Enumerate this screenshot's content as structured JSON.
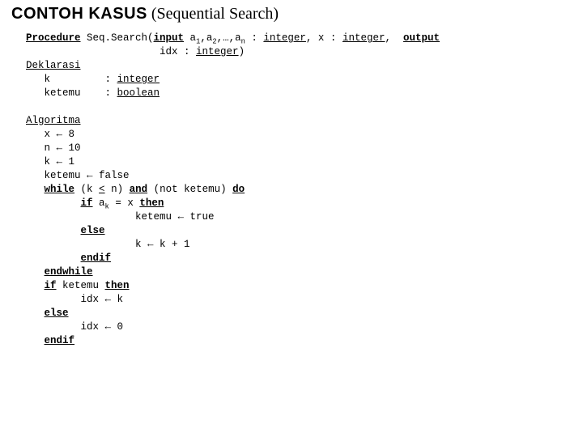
{
  "title": {
    "bold": "CONTOH KASUS",
    "paren": "(Sequential Search)"
  },
  "sig": {
    "kw_proc": "Procedure",
    "name": " Seq.Search(",
    "kw_in": "input",
    "args1": " a",
    "s1": "1",
    "c1": ",a",
    "s2": "2",
    "c2": ",…,a",
    "sn": "n",
    "after_args": " : ",
    "ty1": "integer",
    "mid": ", x : ",
    "ty2": "integer",
    "sep": ",  ",
    "kw_out": "output",
    "line2_pre": "                      idx : ",
    "ty3": "integer",
    "close": ")"
  },
  "decl": {
    "hdr": "Deklarasi",
    "k": "   k",
    "colon": ": ",
    "t_int": "integer",
    "ket": "   ketemu",
    "t_bool": "boolean"
  },
  "alg": {
    "hdr": "Algoritma",
    "l1": "   x ← 8",
    "l2": "   n ← 10",
    "l3": "   k ← 1",
    "l4": "   ketemu ← false",
    "l5a": "   ",
    "kw_while": "while",
    "l5b": " (k ",
    "kw_lt": "<",
    "l5c": " n) ",
    "kw_and": "and",
    "l5d": " (not ketemu) ",
    "kw_do": "do",
    "l6a": "         ",
    "kw_if": "if",
    "l6b": " a",
    "l6sub": "k",
    "l6c": " = x ",
    "kw_then": "then",
    "l7": "                  ketemu ← true",
    "l8a": "         ",
    "kw_else": "else",
    "l9": "                  k ← k + 1",
    "l10a": "         ",
    "kw_endif": "endif",
    "l11a": "   ",
    "kw_endwhile": "endwhile",
    "l12a": "   ",
    "kw_if2": "if",
    "l12b": " ketemu ",
    "kw_then2": "then",
    "l13": "         idx ← k",
    "l14a": "   ",
    "kw_else2": "else",
    "l15": "         idx ← 0",
    "l16a": "   ",
    "kw_endif2": "endif"
  },
  "chart_data": {
    "type": "table",
    "procedure": "Seq.Search",
    "inputs": [
      "a1..an : integer",
      "x : integer"
    ],
    "output": [
      "idx : integer"
    ],
    "declarations": {
      "k": "integer",
      "ketemu": "boolean"
    },
    "initial_values": {
      "x": 8,
      "n": 10,
      "k": 1,
      "ketemu": false
    },
    "algorithm_lines": [
      "x ← 8",
      "n ← 10",
      "k ← 1",
      "ketemu ← false",
      "while (k < n) and (not ketemu) do",
      "  if a_k = x then",
      "    ketemu ← true",
      "  else",
      "    k ← k + 1",
      "  endif",
      "endwhile",
      "if ketemu then",
      "  idx ← k",
      "else",
      "  idx ← 0",
      "endif"
    ]
  }
}
